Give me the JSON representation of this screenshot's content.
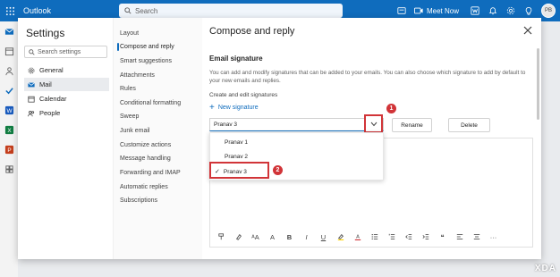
{
  "topbar": {
    "app_name": "Outlook",
    "search_placeholder": "Search",
    "meet_now": "Meet Now",
    "avatar_initials": "PB",
    "brand_color": "#0f6cbd"
  },
  "settings": {
    "title": "Settings",
    "search_placeholder": "Search settings",
    "categories": [
      {
        "label": "General",
        "icon": "gear-icon"
      },
      {
        "label": "Mail",
        "icon": "mail-icon"
      },
      {
        "label": "Calendar",
        "icon": "calendar-icon"
      },
      {
        "label": "People",
        "icon": "people-icon"
      }
    ],
    "active_category": "Mail",
    "subcategories": [
      "Layout",
      "Compose and reply",
      "Smart suggestions",
      "Attachments",
      "Rules",
      "Conditional formatting",
      "Sweep",
      "Junk email",
      "Customize actions",
      "Message handling",
      "Forwarding and IMAP",
      "Automatic replies",
      "Subscriptions"
    ],
    "active_subcategory": "Compose and reply"
  },
  "content": {
    "title": "Compose and reply",
    "section_title": "Email signature",
    "description": "You can add and modify signatures that can be added to your emails. You can also choose which signature to add by default to your new emails and replies.",
    "create_label": "Create and edit signatures",
    "new_signature": "New signature",
    "selected_signature": "Pranav 3",
    "rename_label": "Rename",
    "delete_label": "Delete",
    "dropdown_options": [
      "Pranav 1",
      "Pranav 2",
      "Pranav 3"
    ],
    "annotation_1": "1",
    "annotation_2": "2",
    "annotation_color": "#d13438"
  },
  "toolbar_icons": [
    "format-painter-icon",
    "highlighter-icon",
    "font-size-icon",
    "bold-icon",
    "italic-icon",
    "underline-icon",
    "highlight-color-icon",
    "font-color-icon",
    "bullets-icon",
    "numbering-icon",
    "decrease-indent-icon",
    "increase-indent-icon",
    "quote-icon",
    "align-left-icon",
    "align-center-icon",
    "more-icon"
  ],
  "watermark": "XDA"
}
